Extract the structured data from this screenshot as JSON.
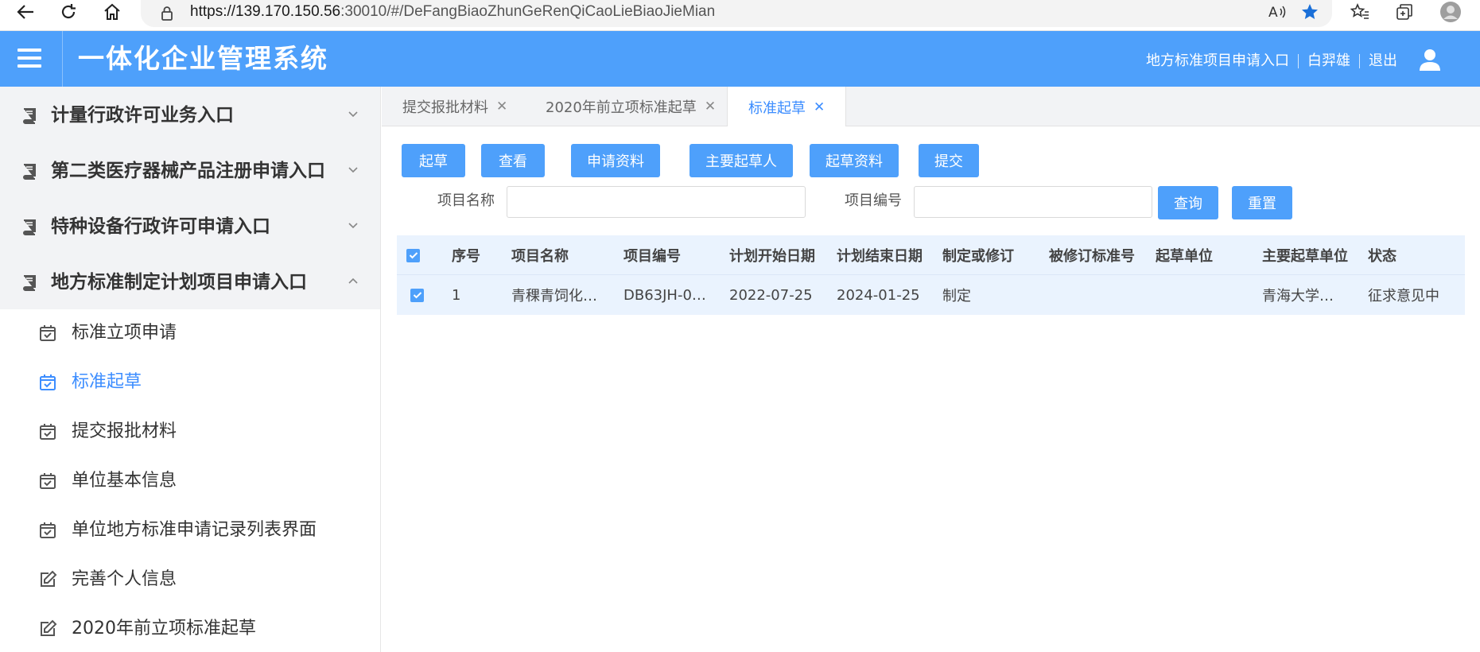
{
  "browser": {
    "url_host": "https://139.170.150.56",
    "url_rest": ":30010/#/DeFangBiaoZhunGeRenQiCaoLieBiaoJieMian"
  },
  "header": {
    "title": "一体化企业管理系统",
    "links": [
      "地方标准项目申请入口",
      "白羿雄",
      "退出"
    ]
  },
  "sidebar": {
    "groups": [
      {
        "label": "计量行政许可业务入口",
        "expanded": false
      },
      {
        "label": "第二类医疗器械产品注册申请入口",
        "expanded": false
      },
      {
        "label": "特种设备行政许可申请入口",
        "expanded": false
      },
      {
        "label": "地方标准制定计划项目申请入口",
        "expanded": true
      }
    ],
    "items": [
      {
        "label": "标准立项申请",
        "icon": "calendar-check-icon",
        "active": false
      },
      {
        "label": "标准起草",
        "icon": "calendar-check-icon",
        "active": true
      },
      {
        "label": "提交报批材料",
        "icon": "calendar-check-icon",
        "active": false
      },
      {
        "label": "单位基本信息",
        "icon": "calendar-check-icon",
        "active": false
      },
      {
        "label": "单位地方标准申请记录列表界面",
        "icon": "calendar-check-icon",
        "active": false
      },
      {
        "label": "完善个人信息",
        "icon": "edit-icon",
        "active": false
      },
      {
        "label": "2020年前立项标准起草",
        "icon": "edit-icon",
        "active": false
      }
    ]
  },
  "tabs": [
    {
      "label": "提交报批材料",
      "active": false
    },
    {
      "label": "2020年前立项标准起草",
      "active": false
    },
    {
      "label": "标准起草",
      "active": true
    }
  ],
  "toolbar": {
    "buttons": [
      "起草",
      "查看",
      "申请资料",
      "主要起草人",
      "起草资料",
      "提交"
    ]
  },
  "search": {
    "name_label": "项目名称",
    "name_value": "",
    "code_label": "项目编号",
    "code_value": "",
    "query_label": "查询",
    "reset_label": "重置"
  },
  "table": {
    "columns": [
      "序号",
      "项目名称",
      "项目编号",
      "计划开始日期",
      "计划结束日期",
      "制定或修订",
      "被修订标准号",
      "起草单位",
      "主要起草单位",
      "状态"
    ],
    "rows": [
      {
        "checked": true,
        "cells": [
          "1",
          "青稞青饲化…",
          "DB63JH-0…",
          "2022-07-25",
          "2024-01-25",
          "制定",
          "",
          "",
          "青海大学…",
          "征求意见中"
        ]
      }
    ]
  },
  "colors": {
    "primary": "#4ea0fb",
    "active_text": "#3c8dff",
    "sidebar_group_bg": "#f2f3f5",
    "table_bg": "#eaf3fe"
  }
}
